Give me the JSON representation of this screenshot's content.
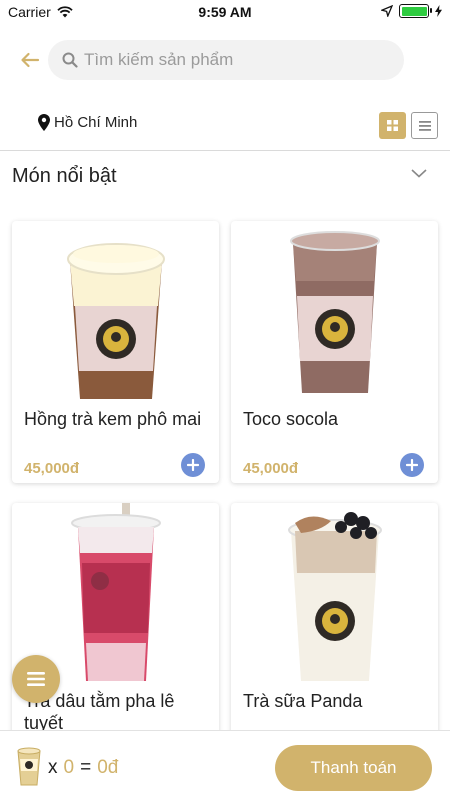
{
  "status_bar": {
    "carrier": "Carrier",
    "time": "9:59 AM"
  },
  "search": {
    "placeholder": "Tìm kiếm sản phẩm"
  },
  "location": {
    "label": "Hồ Chí Minh"
  },
  "section": {
    "title": "Món nổi bật"
  },
  "products": [
    {
      "name": "Hồng trà kem phô mai",
      "price": "45,000đ"
    },
    {
      "name": "Toco socola",
      "price": "45,000đ"
    },
    {
      "name": "Trà dâu tằm pha lê tuyết"
    },
    {
      "name": "Trà sữa Panda"
    }
  ],
  "cart": {
    "x_label": "x",
    "quantity": "0",
    "equals": "=",
    "total": "0đ"
  },
  "checkout": {
    "label": "Thanh toán"
  },
  "icons": {
    "back": "arrow-left-icon",
    "search": "search-icon",
    "location": "map-pin-icon",
    "grid": "grid-view-icon",
    "list": "list-view-icon",
    "chevron": "chevron-down-icon",
    "add": "plus-icon",
    "menu": "menu-icon",
    "cart": "cup-icon"
  },
  "colors": {
    "accent": "#d1b36c",
    "add_button": "#6f8fd6",
    "battery": "#2ecc40"
  }
}
